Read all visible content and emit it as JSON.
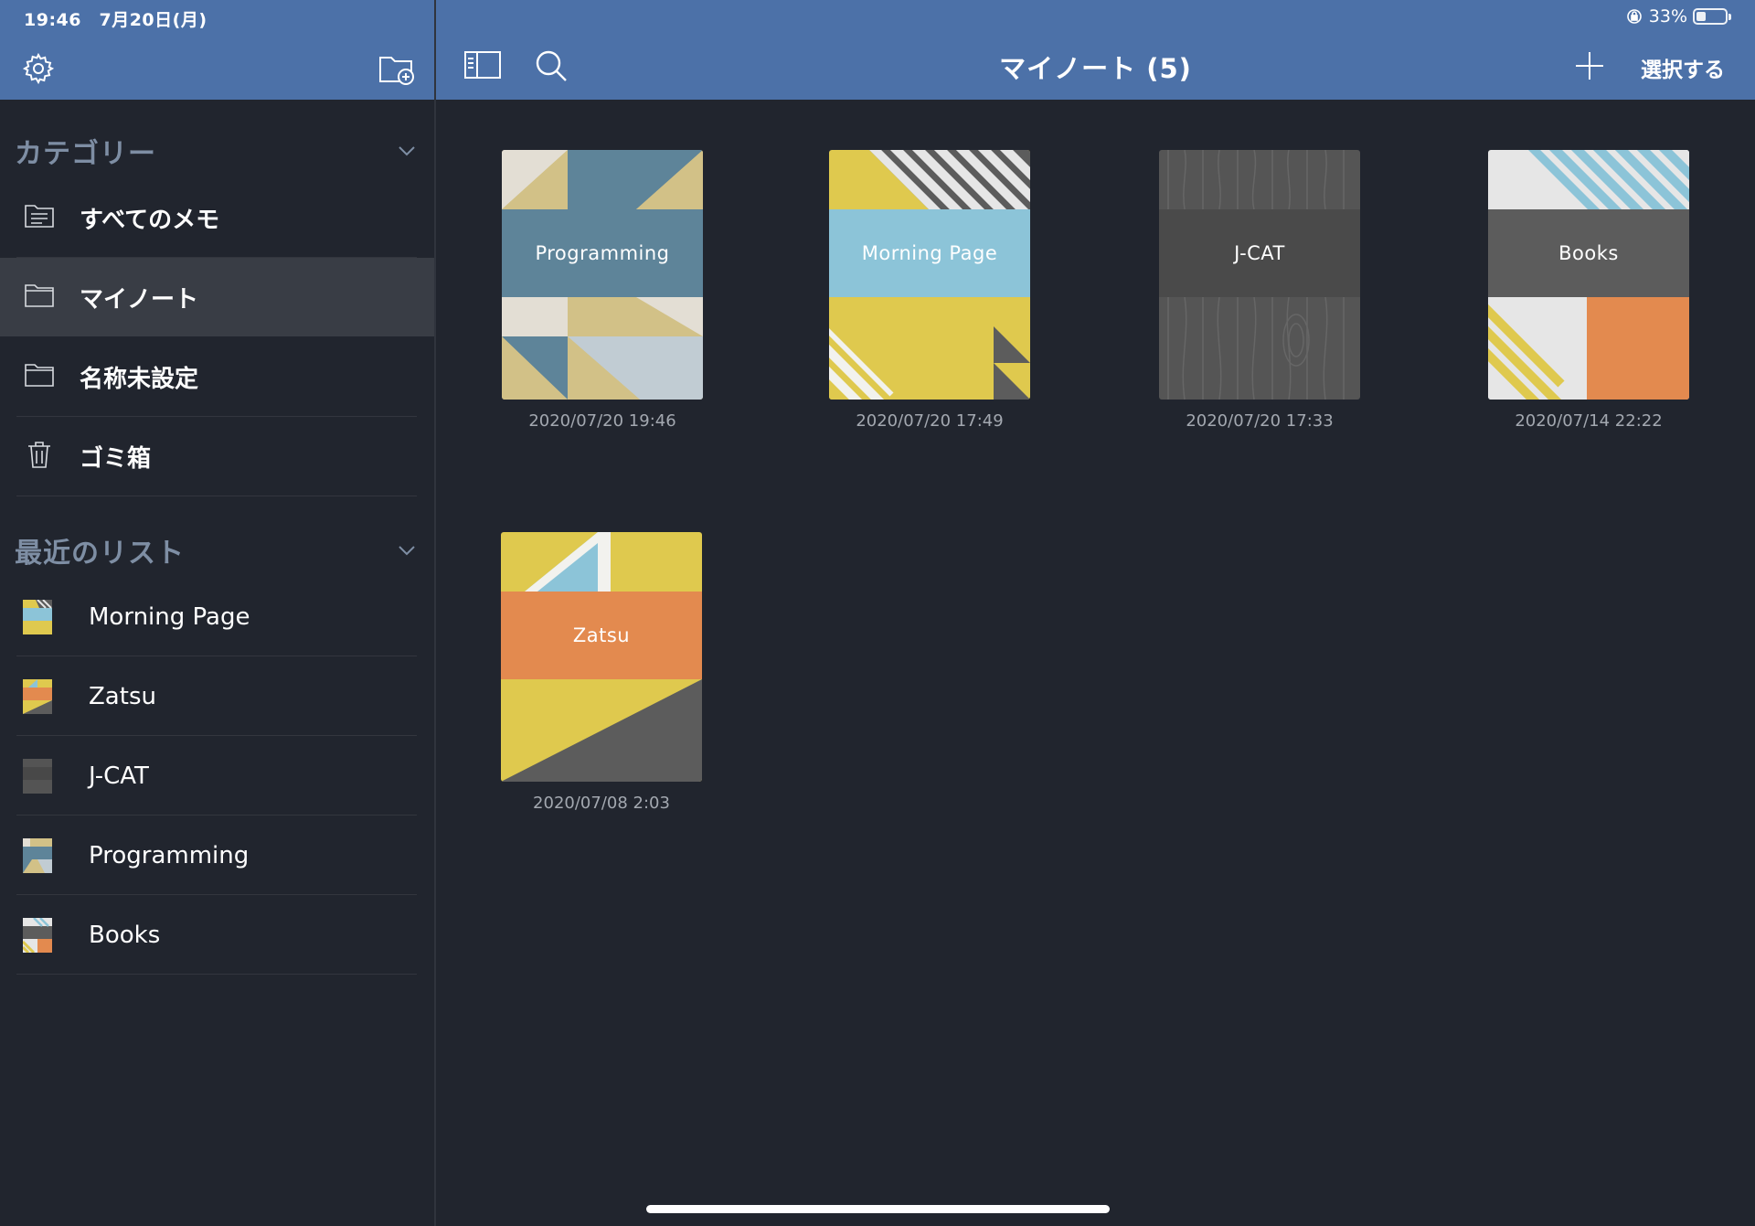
{
  "status": {
    "time": "19:46　7月20日(月)",
    "battery": "33%",
    "battery_level": 0.33
  },
  "nav": {
    "title": "マイノート (5)",
    "select_label": "選択する"
  },
  "sidebar": {
    "categories_title": "カテゴリー",
    "categories": [
      {
        "label": "すべてのメモ",
        "icon": "folder-lines-icon"
      },
      {
        "label": "マイノート",
        "icon": "folder-icon",
        "selected": true
      },
      {
        "label": "名称未設定",
        "icon": "folder-icon"
      },
      {
        "label": "ゴミ箱",
        "icon": "trash-icon"
      }
    ],
    "recent_title": "最近のリスト",
    "recent": [
      {
        "label": "Morning Page"
      },
      {
        "label": "Zatsu"
      },
      {
        "label": "J-CAT"
      },
      {
        "label": "Programming"
      },
      {
        "label": "Books"
      }
    ]
  },
  "notebooks": [
    {
      "title": "Programming",
      "date": "2020/07/20 19:46"
    },
    {
      "title": "Morning Page",
      "date": "2020/07/20 17:49"
    },
    {
      "title": "J-CAT",
      "date": "2020/07/20 17:33"
    },
    {
      "title": "Books",
      "date": "2020/07/14 22:22"
    },
    {
      "title": "Zatsu",
      "date": "2020/07/08 2:03"
    }
  ],
  "colors": {
    "header": "#4c71a8",
    "background": "#21252e",
    "selected_row": "#393d45",
    "section_title": "#7e8ea4",
    "yellow": "#dfc94e",
    "sky": "#8cc4d8",
    "orange": "#e38a4f",
    "gray": "#5c5c5c",
    "teal": "#5e8499",
    "tan": "#d2c187"
  }
}
